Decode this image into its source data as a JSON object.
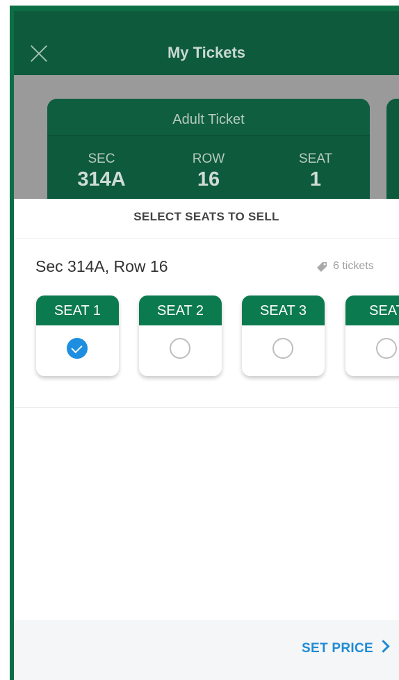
{
  "header": {
    "title": "My Tickets"
  },
  "ticket": {
    "type": "Adult Ticket",
    "sec_label": "SEC",
    "sec": "314A",
    "row_label": "ROW",
    "row": "16",
    "seat_label": "SEAT",
    "seat": "1"
  },
  "sheet": {
    "title": "SELECT SEATS TO SELL",
    "location": "Sec 314A, Row 16",
    "ticket_count": "6 tickets",
    "seats": [
      {
        "label": "SEAT 1",
        "selected": true
      },
      {
        "label": "SEAT 2",
        "selected": false
      },
      {
        "label": "SEAT 3",
        "selected": false
      },
      {
        "label": "SEAT",
        "selected": false
      }
    ]
  },
  "footer": {
    "action": "SET PRICE"
  },
  "colors": {
    "brand_green": "#0c7a4f",
    "header_green": "#0e5a3d",
    "accent_blue": "#1f8bd6",
    "check_blue": "#1e8fe0"
  },
  "icons": {
    "close": "close-icon",
    "tag": "tag-icon",
    "check": "check-icon",
    "chevron": "chevron-right-icon"
  }
}
